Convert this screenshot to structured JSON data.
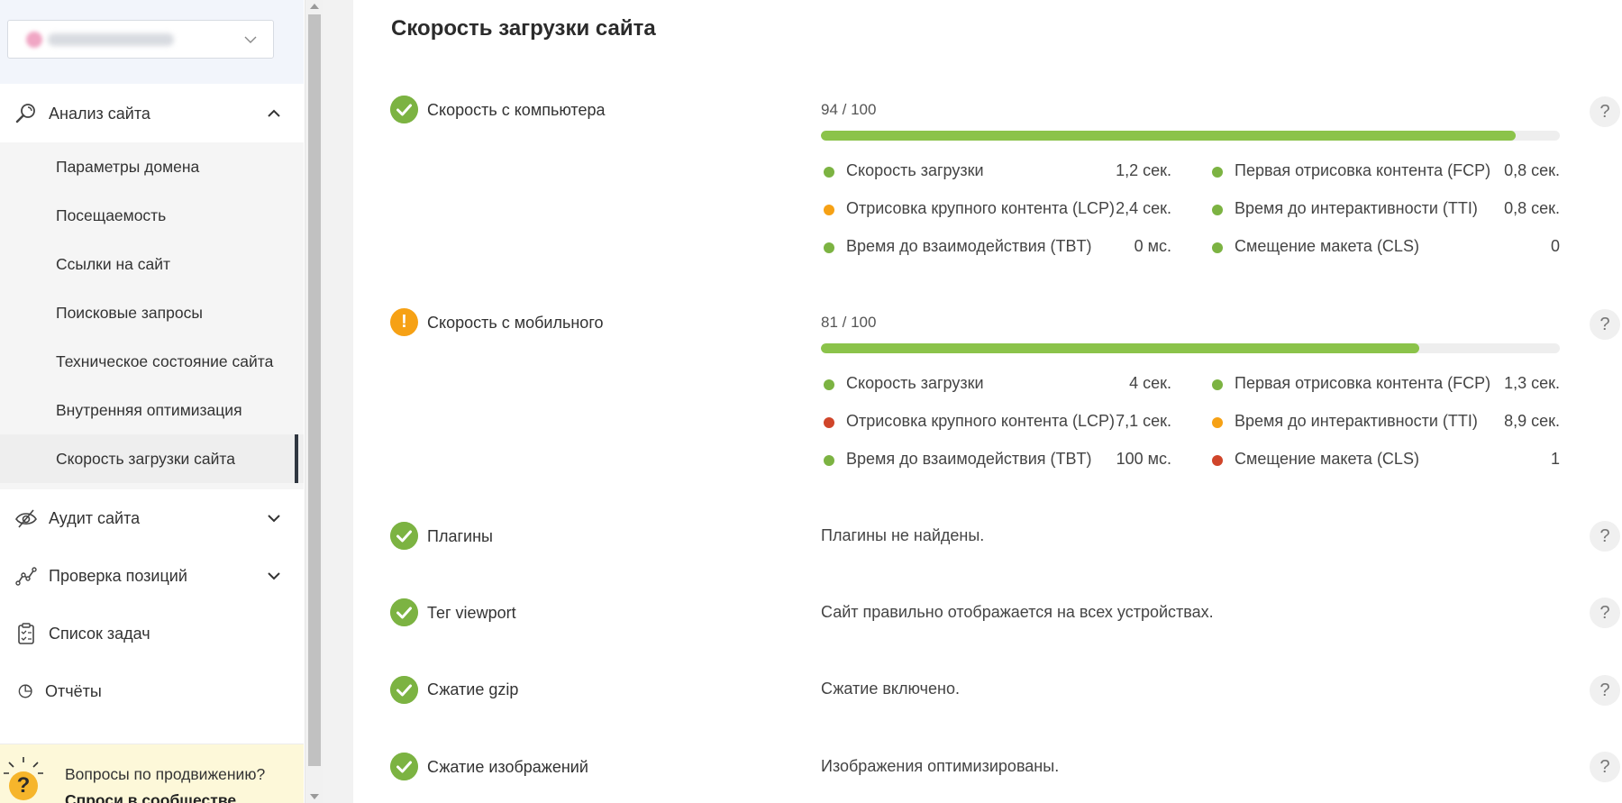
{
  "colors": {
    "good": "#7cb342",
    "warn": "#f6a115",
    "bad": "#d0452a",
    "bar": "#8bc34a"
  },
  "sidebar": {
    "analysis_label": "Анализ сайта",
    "sub_items": [
      "Параметры домена",
      "Посещаемость",
      "Ссылки на сайт",
      "Поисковые запросы",
      "Техническое состояние сайта",
      "Внутренняя оптимизация",
      "Скорость загрузки сайта"
    ],
    "audit_label": "Аудит сайта",
    "positions_label": "Проверка позиций",
    "tasks_label": "Список задач",
    "reports_label": "Отчёты",
    "help_line1": "Вопросы по продвижению?",
    "help_line2": "Спроси в сообществе"
  },
  "main": {
    "title": "Скорость загрузки сайта",
    "desktop": {
      "label": "Скорость с компьютера",
      "score": "94 / 100",
      "score_fraction": 0.94,
      "metrics": [
        {
          "label": "Скорость загрузки",
          "value": "1,2 сек.",
          "status": "good"
        },
        {
          "label": "Первая отрисовка контента (FCP)",
          "value": "0,8 сек.",
          "status": "good"
        },
        {
          "label": "Отрисовка крупного контента (LCP)",
          "value": "2,4 сек.",
          "status": "warn"
        },
        {
          "label": "Время до интерактивности (TTI)",
          "value": "0,8 сек.",
          "status": "good"
        },
        {
          "label": "Время до взаимодействия (TBT)",
          "value": "0 мс.",
          "status": "good"
        },
        {
          "label": "Смещение макета (CLS)",
          "value": "0",
          "status": "good"
        }
      ]
    },
    "mobile": {
      "label": "Скорость с мобильного",
      "score": "81 / 100",
      "score_fraction": 0.81,
      "metrics": [
        {
          "label": "Скорость загрузки",
          "value": "4 сек.",
          "status": "good"
        },
        {
          "label": "Первая отрисовка контента (FCP)",
          "value": "1,3 сек.",
          "status": "good"
        },
        {
          "label": "Отрисовка крупного контента (LCP)",
          "value": "7,1 сек.",
          "status": "bad"
        },
        {
          "label": "Время до интерактивности (TTI)",
          "value": "8,9 сек.",
          "status": "warn"
        },
        {
          "label": "Время до взаимодействия (TBT)",
          "value": "100 мс.",
          "status": "good"
        },
        {
          "label": "Смещение макета (CLS)",
          "value": "1",
          "status": "bad"
        }
      ]
    },
    "checks": [
      {
        "label": "Плагины",
        "text": "Плагины не найдены."
      },
      {
        "label": "Тег viewport",
        "text": "Сайт правильно отображается на всех устройствах."
      },
      {
        "label": "Сжатие gzip",
        "text": "Сжатие включено."
      },
      {
        "label": "Сжатие изображений",
        "text": "Изображения оптимизированы."
      }
    ],
    "help_glyph": "?",
    "warn_glyph": "!"
  }
}
